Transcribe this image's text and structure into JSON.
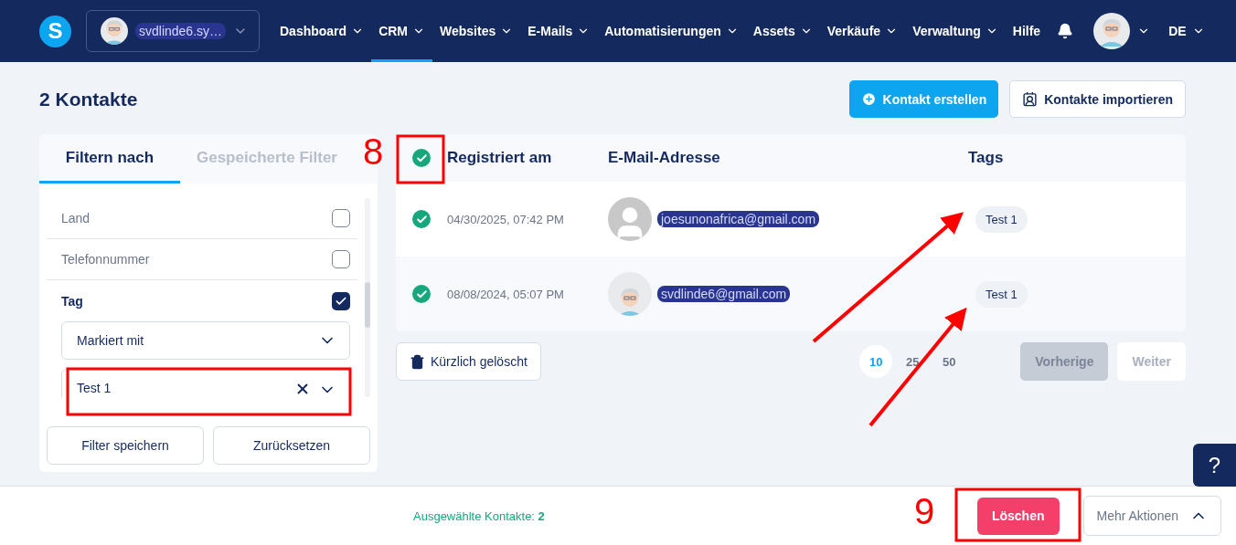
{
  "header": {
    "logo": "S",
    "account": "svdlinde6.sy…",
    "nav": [
      {
        "label": "Dashboard",
        "selected": false,
        "dropdown": true
      },
      {
        "label": "CRM",
        "selected": true,
        "dropdown": true
      },
      {
        "label": "Websites",
        "selected": false,
        "dropdown": true
      },
      {
        "label": "E-Mails",
        "selected": false,
        "dropdown": true
      },
      {
        "label": "Automatisierungen",
        "selected": false,
        "dropdown": true
      },
      {
        "label": "Assets",
        "selected": false,
        "dropdown": true
      },
      {
        "label": "Verkäufe",
        "selected": false,
        "dropdown": true
      },
      {
        "label": "Verwaltung",
        "selected": false,
        "dropdown": true
      },
      {
        "label": "Hilfe",
        "selected": false,
        "dropdown": false
      }
    ],
    "language": "DE"
  },
  "page": {
    "title": "2 Kontakte",
    "actions": [
      {
        "label": "Kontakt erstellen",
        "kind": "primary"
      },
      {
        "label": "Kontakte importieren",
        "kind": "secondary"
      }
    ]
  },
  "filter_panel": {
    "tabs": [
      {
        "label": "Filtern nach",
        "selected": true
      },
      {
        "label": "Gespeicherte Filter",
        "selected": false
      }
    ],
    "items": [
      {
        "label": "Land",
        "checked": false
      },
      {
        "label": "Telefonnummer",
        "checked": false
      },
      {
        "label": "Tag",
        "checked": true
      }
    ],
    "condition": "Markiert mit",
    "tag_value": "Test 1",
    "buttons": [
      "Filter speichern",
      "Zurücksetzen"
    ]
  },
  "table": {
    "all_selected": true,
    "columns": [
      "Registriert am",
      "E-Mail-Adresse",
      "Tags"
    ],
    "rows": [
      {
        "selected": true,
        "date": "04/30/2025, 07:42 PM",
        "email": "joesunonafrica@gmail.com",
        "kind": "placeholder",
        "tags": [
          "Test 1"
        ]
      },
      {
        "selected": true,
        "date": "08/08/2024, 05:07 PM",
        "email": "svdlinde6@gmail.com",
        "kind": "illustrated",
        "tags": [
          "Test 1"
        ]
      }
    ]
  },
  "footer_bar": {
    "recently_deleted": "Kürzlich gelöscht",
    "page_sizes": [
      {
        "label": "10",
        "selected": true
      },
      {
        "label": "25",
        "selected": false
      },
      {
        "label": "50",
        "selected": false
      }
    ],
    "pager": [
      {
        "label": "Vorherige",
        "kind": "filled",
        "disabled": true
      },
      {
        "label": "Weiter",
        "kind": "plain",
        "disabled": true
      }
    ]
  },
  "selection_bar": {
    "label": "Ausgewählte Kontakte:",
    "count": "2",
    "delete": "Löschen",
    "more": "Mehr Aktionen"
  },
  "help": "?",
  "annotations": [
    {
      "label": "8"
    },
    {
      "label": "9"
    }
  ]
}
